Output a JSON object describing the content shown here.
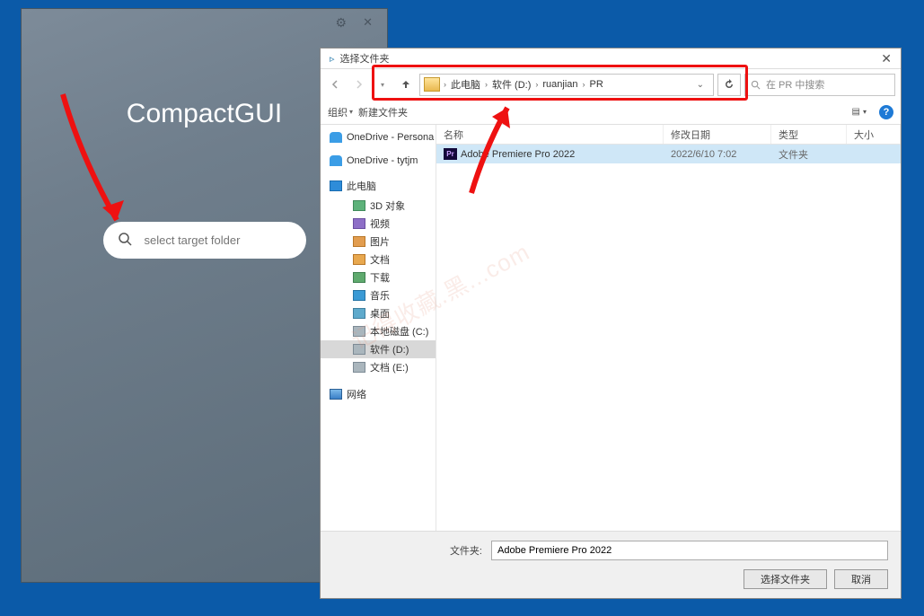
{
  "compactgui": {
    "title": "CompactGUI",
    "search_placeholder": "select target folder"
  },
  "dialog": {
    "title": "选择文件夹",
    "breadcrumbs": [
      "此电脑",
      "软件 (D:)",
      "ruanjian",
      "PR"
    ],
    "search_placeholder": "在 PR 中搜索",
    "toolbar": {
      "organize": "组织",
      "newfolder": "新建文件夹"
    },
    "columns": {
      "name": "名称",
      "date": "修改日期",
      "type": "类型",
      "size": "大小"
    },
    "tree": {
      "onedrive_personal": "OneDrive - Persona",
      "onedrive_tytjm": "OneDrive - tytjm",
      "this_pc": "此电脑",
      "d3": "3D 对象",
      "video": "视频",
      "pictures": "图片",
      "documents": "文档",
      "downloads": "下载",
      "music": "音乐",
      "desktop": "桌面",
      "drive_c": "本地磁盘 (C:)",
      "drive_d": "软件 (D:)",
      "drive_e": "文档 (E:)",
      "network": "网络"
    },
    "files": [
      {
        "name": "Adobe Premiere Pro 2022",
        "date": "2022/6/10 7:02",
        "type": "文件夹",
        "size": ""
      }
    ],
    "footer": {
      "label": "文件夹:",
      "value": "Adobe Premiere Pro 2022",
      "ok": "选择文件夹",
      "cancel": "取消"
    }
  },
  "watermark": "记得收藏.黑...com"
}
